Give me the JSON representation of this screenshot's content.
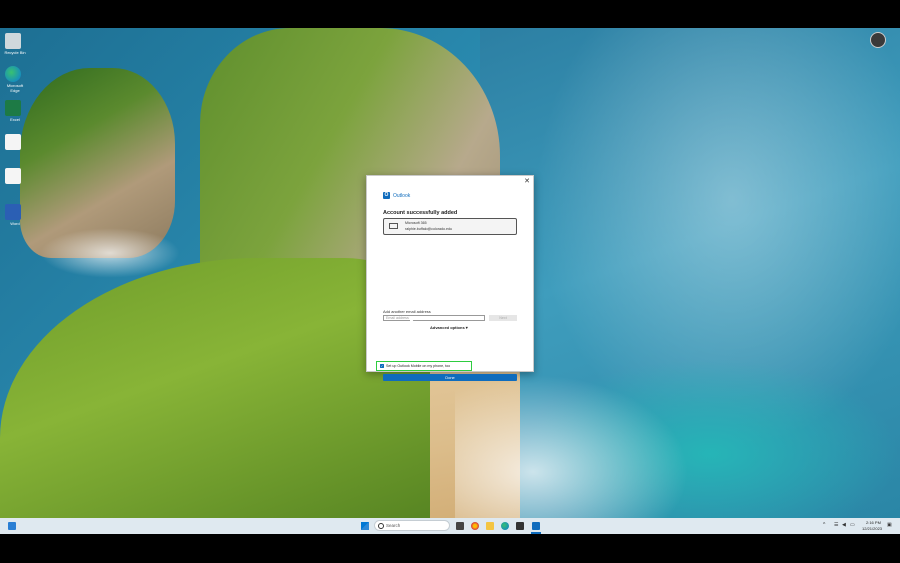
{
  "desktop": {
    "icons": [
      {
        "name": "recycle-bin-icon",
        "label": "Recycle Bin"
      },
      {
        "name": "edge-icon",
        "label": "Microsoft Edge"
      },
      {
        "name": "excel-icon",
        "label": "Excel"
      },
      {
        "name": "file-icon",
        "label": ""
      },
      {
        "name": "file-icon",
        "label": ""
      },
      {
        "name": "word-icon",
        "label": "Word"
      }
    ]
  },
  "dialog": {
    "close_glyph": "✕",
    "brand": "Outlook",
    "title": "Account successfully added",
    "account": {
      "type": "Microsoft 365",
      "email": "ralphie.buffalo@colorado.edu"
    },
    "add_another": {
      "label": "Add another email address",
      "placeholder": "Email address",
      "next_label": "Next"
    },
    "advanced_label": "Advanced options ▾",
    "mobile_option": {
      "label": "Set up Outlook Mobile on my phone, too",
      "checked": true
    },
    "done_label": "Done"
  },
  "taskbar": {
    "search_label": "Search",
    "clock": {
      "time": "2:16 PM",
      "date": "12/21/2023"
    },
    "tray": {
      "chevron": "^",
      "wifi": "☰",
      "sound": "◀",
      "battery": "▭",
      "notification": "▣"
    }
  },
  "colors": {
    "accent": "#0f6cbd",
    "highlight": "#2ecc40"
  }
}
